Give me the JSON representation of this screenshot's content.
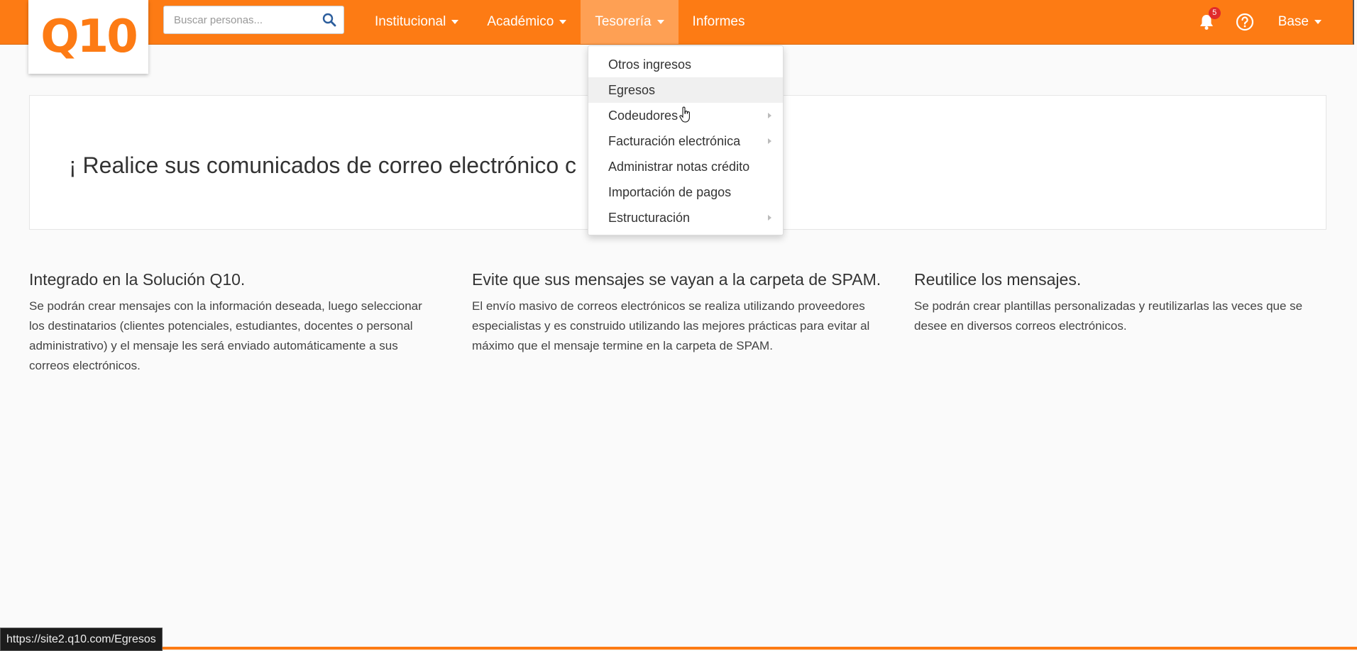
{
  "header": {
    "logo_text": "Q10",
    "search": {
      "placeholder": "Buscar personas...",
      "value": ""
    },
    "nav": [
      {
        "label": "Institucional",
        "dropdown": true
      },
      {
        "label": "Académico",
        "dropdown": true
      },
      {
        "label": "Tesorería",
        "dropdown": true,
        "active": true
      },
      {
        "label": "Informes",
        "dropdown": false
      }
    ],
    "notifications_count": "5",
    "user_menu": "Base"
  },
  "dropdown": {
    "items": [
      {
        "label": "Otros ingresos",
        "submenu": false
      },
      {
        "label": "Egresos",
        "submenu": false,
        "hover": true
      },
      {
        "label": "Codeudores",
        "submenu": true
      },
      {
        "label": "Facturación electrónica",
        "submenu": true
      },
      {
        "label": "Administrar notas crédito",
        "submenu": false
      },
      {
        "label": "Importación de pagos",
        "submenu": false
      },
      {
        "label": "Estructuración",
        "submenu": true
      }
    ]
  },
  "hero": {
    "text": "¡ Realice sus comunicados de correo electrónico c"
  },
  "features": [
    {
      "title": "Integrado en la Solución Q10.",
      "body": "Se podrán crear mensajes con la información deseada, luego seleccionar los destinatarios (clientes potenciales, estudiantes, docentes o personal administrativo) y el mensaje les será enviado automáticamente a sus correos electrónicos."
    },
    {
      "title": "Evite que sus mensajes se vayan a la carpeta de SPAM.",
      "body": "El envío masivo de correos electrónicos se realiza utilizando proveedores especialistas y es construido utilizando las mejores prácticas para evitar al máximo que el mensaje termine en la carpeta de SPAM."
    },
    {
      "title": "Reutilice los mensajes.",
      "body": "Se podrán crear plantillas personalizadas y reutilizarlas las veces que se desee en diversos correos electrónicos."
    }
  ],
  "status_bar": {
    "url": "https://site2.q10.com/Egresos"
  },
  "colors": {
    "brand": "#fd7b14",
    "active_nav": "#fea054",
    "badge": "#e02b2b"
  }
}
